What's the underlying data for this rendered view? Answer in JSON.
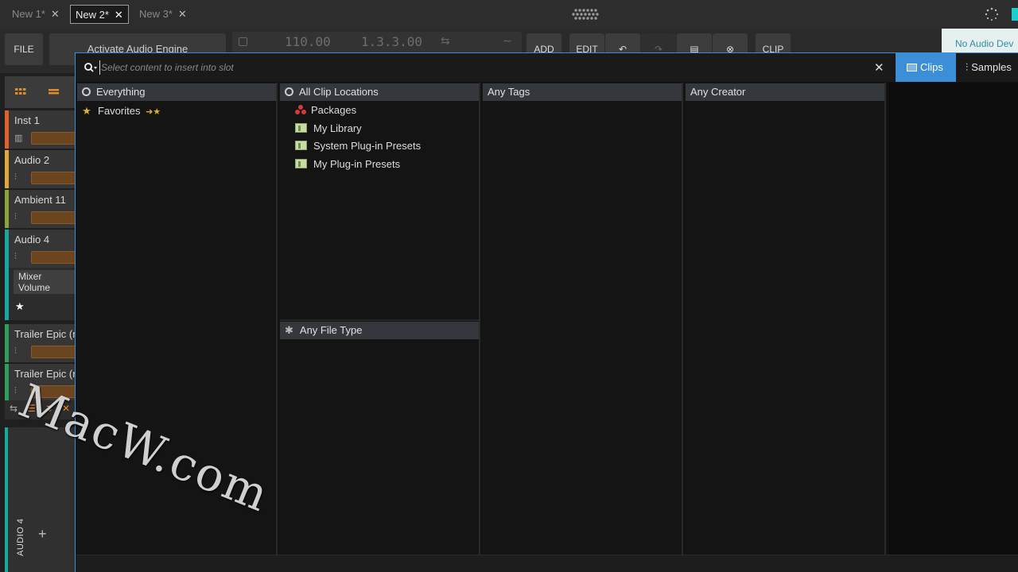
{
  "tabs": [
    {
      "label": "New 1*",
      "active": false
    },
    {
      "label": "New 2*",
      "active": true
    },
    {
      "label": "New 3*",
      "active": false
    }
  ],
  "tab_close_glyph": "✕",
  "toolbar": {
    "file_label": "FILE",
    "activate_label": "Activate Audio Engine",
    "tempo": "110.00",
    "position": "1.3.3.00",
    "add_label": "ADD",
    "edit_label": "EDIT",
    "clip_label": "CLIP",
    "no_audio_label": "No Audio Dev"
  },
  "tracks": [
    {
      "name": "Inst 1",
      "color": "#e2602a",
      "icon": "piano-icon"
    },
    {
      "name": "Audio 2",
      "color": "#e0a83a",
      "icon": "waveform-icon"
    },
    {
      "name": "Ambient 11",
      "color": "#8aa33a",
      "icon": "waveform-icon"
    },
    {
      "name": "Audio 4",
      "color": "#19a8a0",
      "icon": "waveform-icon"
    },
    {
      "name": "Trailer Epic (m",
      "color": "#2f9e5a",
      "icon": "waveform-icon"
    },
    {
      "name": "Trailer Epic (m",
      "color": "#2f9e5a",
      "icon": "waveform-icon"
    }
  ],
  "mixer_volume_label": "Mixer Volume",
  "bottom_track_label": "AUDIO 4",
  "browser": {
    "search_placeholder": "Select content to insert into slot",
    "tab_clips": "Clips",
    "tab_samples": "Samples",
    "col1": {
      "header": "Everything",
      "items": [
        {
          "label": "Favorites",
          "suffix": "➜★"
        }
      ]
    },
    "col2": {
      "header": "All Clip Locations",
      "items": [
        {
          "label": "Packages",
          "icon": "packages-icon"
        },
        {
          "label": "My Library",
          "icon": "library-icon"
        },
        {
          "label": "System Plug-in Presets",
          "icon": "library-icon"
        },
        {
          "label": "My Plug-in Presets",
          "icon": "library-icon"
        }
      ],
      "filetype_header": "Any File Type"
    },
    "col3": {
      "header": "Any Tags"
    },
    "col4": {
      "header": "Any Creator"
    }
  },
  "watermark": "MacW.com"
}
